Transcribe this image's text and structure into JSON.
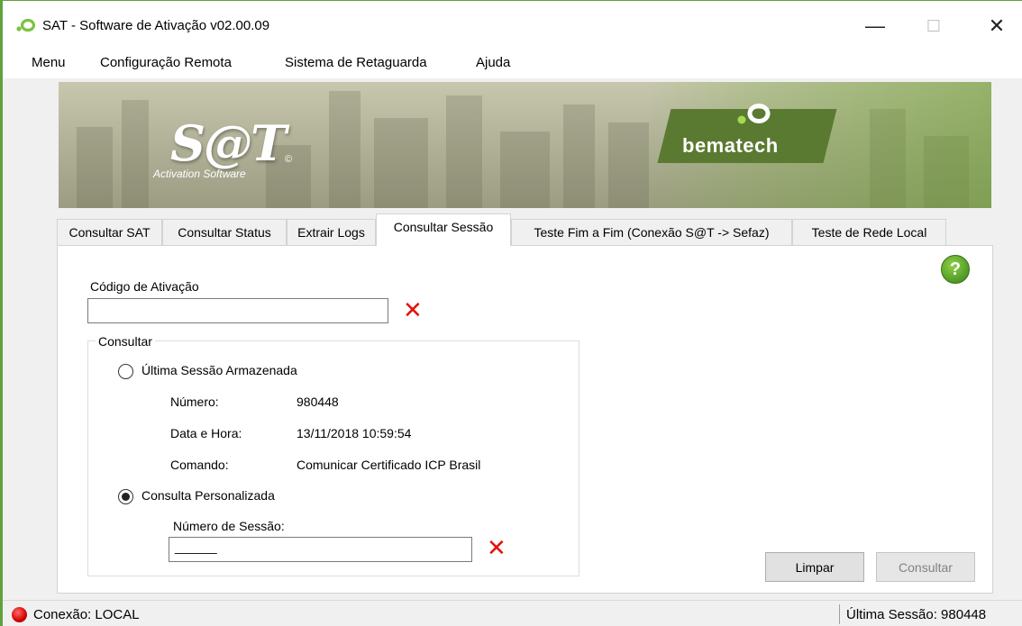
{
  "window": {
    "title": "SAT - Software de Ativação v02.00.09",
    "controls": {
      "minimize": "—",
      "maximize": "☐",
      "close": "✕"
    }
  },
  "menu": [
    "Menu",
    "Configuração Remota",
    "Sistema de Retaguarda",
    "Ajuda"
  ],
  "banner": {
    "product_logo": "S@T",
    "product_subtitle": "Activation Software",
    "copyright_mark": "©",
    "brand": "bematech"
  },
  "tabs": [
    {
      "label": "Consultar SAT",
      "active": false
    },
    {
      "label": "Consultar Status",
      "active": false
    },
    {
      "label": "Extrair Logs",
      "active": false
    },
    {
      "label": "Consultar Sessão",
      "active": true
    },
    {
      "label": "Teste Fim a Fim (Conexão S@T -> Sefaz)",
      "active": false
    },
    {
      "label": "Teste de Rede Local",
      "active": false
    }
  ],
  "help": {
    "label": "?"
  },
  "activation": {
    "label": "Código de Ativação",
    "value": "",
    "error_icon": "✕"
  },
  "consultar": {
    "legend": "Consultar",
    "last_session": {
      "label": "Última Sessão Armazenada",
      "selected": false,
      "fields": [
        {
          "label": "Número:",
          "value": "980448"
        },
        {
          "label": "Data e Hora:",
          "value": "13/11/2018 10:59:54"
        },
        {
          "label": "Comando:",
          "value": "Comunicar Certificado ICP Brasil"
        }
      ]
    },
    "custom": {
      "label": "Consulta Personalizada",
      "selected": true,
      "session_label": "Número de Sessão:",
      "session_value": "______",
      "error_icon": "✕"
    }
  },
  "buttons": {
    "clear": "Limpar",
    "query": "Consultar"
  },
  "status": {
    "connection": "Conexão: LOCAL",
    "last_session": "Última Sessão: 980448"
  },
  "colors": {
    "accent_green": "#5fa23b",
    "error_red": "#e3120b",
    "status_red": "#d40000"
  }
}
